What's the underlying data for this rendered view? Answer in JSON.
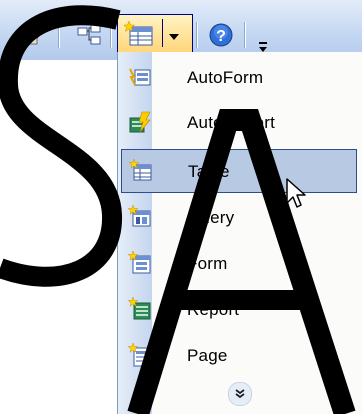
{
  "menu": {
    "items": [
      {
        "label": "AutoForm",
        "icon": "autoform-icon"
      },
      {
        "label": "AutoReport",
        "icon": "autoreport-icon"
      },
      {
        "label": "Table",
        "icon": "table-icon",
        "selected": true
      },
      {
        "label": "Query",
        "icon": "query-icon"
      },
      {
        "label": "Form",
        "icon": "form-icon"
      },
      {
        "label": "Report",
        "icon": "report-icon"
      },
      {
        "label": "Page",
        "icon": "page-icon"
      }
    ],
    "expand_icon": "double-chevron-down-icon"
  },
  "toolbar": {
    "icons": [
      "properties-icon",
      "relationships-icon",
      "new-object-icon",
      "dropdown-arrow-icon",
      "help-icon",
      "toolbar-options-icon"
    ]
  },
  "watermark": "SA",
  "colors": {
    "selected_bg": "#b8c9e4",
    "selected_border": "#2e4d8e",
    "toolbar": "#c5d8f2"
  }
}
